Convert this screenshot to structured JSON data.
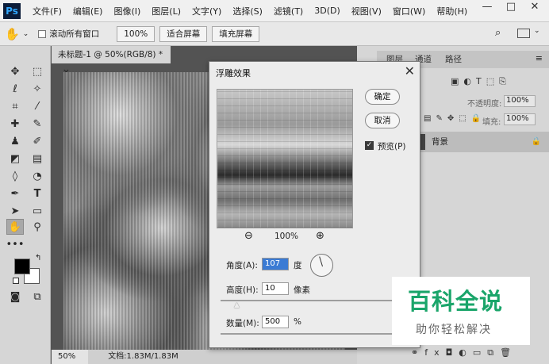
{
  "app": {
    "logo": "Ps"
  },
  "menu": [
    "文件(F)",
    "编辑(E)",
    "图像(I)",
    "图层(L)",
    "文字(Y)",
    "选择(S)",
    "滤镜(T)",
    "3D(D)",
    "视图(V)",
    "窗口(W)",
    "帮助(H)"
  ],
  "window_controls": {
    "minimize": "—",
    "maximize": "□",
    "close": "✕"
  },
  "options_bar": {
    "scroll_all_label": "滚动所有窗口",
    "zoom_100": "100%",
    "fit_screen": "适合屏幕",
    "fill_screen": "填充屏幕"
  },
  "document": {
    "tab_title": "未标题-1 @ 50%(RGB/8) *",
    "status_zoom": "50%",
    "status_doc": "文档:1.83M/1.83M"
  },
  "panels": {
    "tabs": [
      "图层",
      "通道",
      "路径"
    ],
    "opacity_label": "不透明度:",
    "opacity_value": "100%",
    "fill_label": "填充:",
    "fill_value": "100%",
    "layer_name": "背景"
  },
  "dialog": {
    "title": "浮雕效果",
    "ok": "确定",
    "cancel": "取消",
    "preview_label": "预览(P)",
    "preview_checked": true,
    "zoom_value": "100%",
    "angle_label": "角度(A):",
    "angle_value": "107",
    "angle_unit": "度",
    "height_label": "高度(H):",
    "height_value": "10",
    "height_unit": "像素",
    "amount_label": "数量(M):",
    "amount_value": "500",
    "amount_unit": "%"
  },
  "watermark": {
    "title": "百科全说",
    "subtitle": "助你轻松解决"
  }
}
